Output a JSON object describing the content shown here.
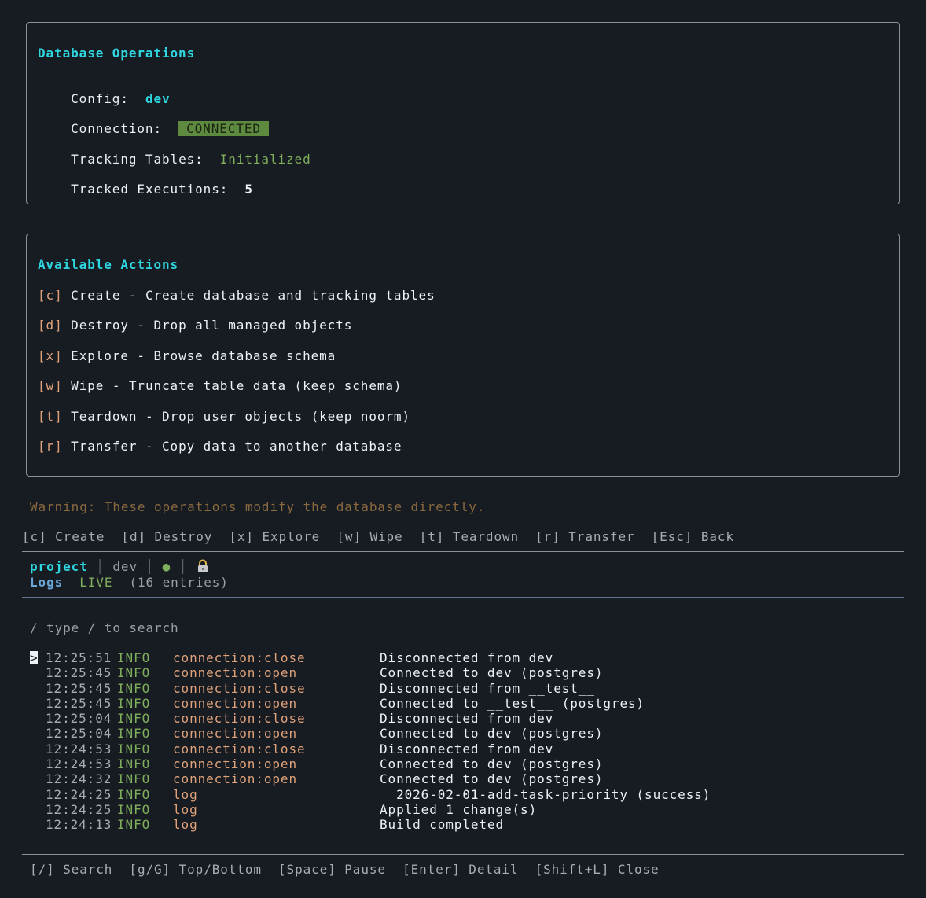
{
  "db_panel": {
    "title": "Database Operations",
    "config_label": "Config:",
    "config_value": "dev",
    "connection_label": "Connection:",
    "connection_value": "CONNECTED",
    "tracking_label": "Tracking Tables:",
    "tracking_value": "Initialized",
    "executions_label": "Tracked Executions:",
    "executions_value": "5"
  },
  "actions_panel": {
    "title": "Available Actions",
    "items": [
      {
        "key": "[c]",
        "text": "Create - Create database and tracking tables"
      },
      {
        "key": "[d]",
        "text": "Destroy - Drop all managed objects"
      },
      {
        "key": "[x]",
        "text": "Explore - Browse database schema"
      },
      {
        "key": "[w]",
        "text": "Wipe - Truncate table data (keep schema)"
      },
      {
        "key": "[t]",
        "text": "Teardown - Drop user objects (keep noorm)"
      },
      {
        "key": "[r]",
        "text": "Transfer - Copy data to another database"
      }
    ]
  },
  "warning": "Warning: These operations modify the database directly.",
  "shortcut_bar": [
    "[c] Create",
    "[d] Destroy",
    "[x] Explore",
    "[w] Wipe",
    "[t] Teardown",
    "[r] Transfer",
    "[Esc] Back"
  ],
  "status": {
    "project": "project",
    "config": "dev",
    "dot": "●",
    "lock_icon": "lock-icon",
    "logs_label": "Logs",
    "live_label": "LIVE",
    "entries": "(16 entries)"
  },
  "search": {
    "placeholder": "/ type / to search"
  },
  "logs": {
    "cursor": ">",
    "rows": [
      {
        "time": "12:25:51",
        "level": "INFO",
        "event": "connection:close",
        "message": "Disconnected from dev"
      },
      {
        "time": "12:25:45",
        "level": "INFO",
        "event": "connection:open",
        "message": "Connected to dev (postgres)"
      },
      {
        "time": "12:25:45",
        "level": "INFO",
        "event": "connection:close",
        "message": "Disconnected from __test__"
      },
      {
        "time": "12:25:45",
        "level": "INFO",
        "event": "connection:open",
        "message": "Connected to __test__ (postgres)"
      },
      {
        "time": "12:25:04",
        "level": "INFO",
        "event": "connection:close",
        "message": "Disconnected from dev"
      },
      {
        "time": "12:25:04",
        "level": "INFO",
        "event": "connection:open",
        "message": "Connected to dev (postgres)"
      },
      {
        "time": "12:24:53",
        "level": "INFO",
        "event": "connection:close",
        "message": "Disconnected from dev"
      },
      {
        "time": "12:24:53",
        "level": "INFO",
        "event": "connection:open",
        "message": "Connected to dev (postgres)"
      },
      {
        "time": "12:24:32",
        "level": "INFO",
        "event": "connection:open",
        "message": "Connected to dev (postgres)"
      },
      {
        "time": "12:24:25",
        "level": "INFO",
        "event": "log",
        "message": "  2026-02-01-add-task-priority (success)"
      },
      {
        "time": "12:24:25",
        "level": "INFO",
        "event": "log",
        "message": "Applied 1 change(s)"
      },
      {
        "time": "12:24:13",
        "level": "INFO",
        "event": "log",
        "message": "Build completed"
      }
    ]
  },
  "footer_hints": [
    "[/] Search",
    "[g/G] Top/Bottom",
    "[Space] Pause",
    "[Enter] Detail",
    "[Shift+L] Close"
  ],
  "colors": {
    "background": "#171b22",
    "accent_cyan": "#2fd6df",
    "success_green": "#7fae5c",
    "key_orange": "#e0a27a",
    "badge_green": "#5d8a3e",
    "warning_brown": "#8a6a3f"
  }
}
